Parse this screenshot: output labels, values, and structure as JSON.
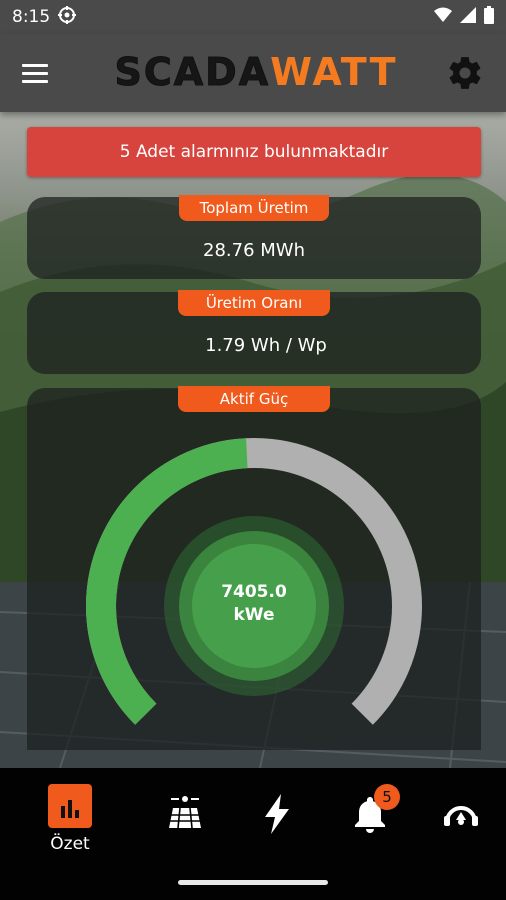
{
  "status_bar": {
    "time": "8:15"
  },
  "app": {
    "logo_part1": "SCADA",
    "logo_part2": "WATT",
    "brand_color": "#f47b20"
  },
  "alarm_banner": {
    "text": "5 Adet alarmınız bulunmaktadır",
    "color": "#d7443d"
  },
  "cards": {
    "total_production": {
      "label": "Toplam Üretim",
      "value": "28.76 MWh"
    },
    "production_ratio": {
      "label": "Üretim Oranı",
      "value": "1.79 Wh / Wp"
    },
    "active_power": {
      "label": "Aktif Güç",
      "value": "7405.0",
      "unit": "kWe",
      "gauge_fill_fraction": 0.49
    }
  },
  "bottom_nav": {
    "items": [
      {
        "label": "Özet",
        "icon": "bar-chart-icon",
        "active": true
      },
      {
        "label": "",
        "icon": "solar-panel-icon"
      },
      {
        "label": "",
        "icon": "lightning-icon"
      },
      {
        "label": "",
        "icon": "bell-icon",
        "badge": "5"
      },
      {
        "label": "",
        "icon": "monitor-user-icon"
      }
    ]
  },
  "colors": {
    "accent": "#f05a1c",
    "gauge_fill": "#4caf50",
    "gauge_track": "#b0b0b0"
  }
}
